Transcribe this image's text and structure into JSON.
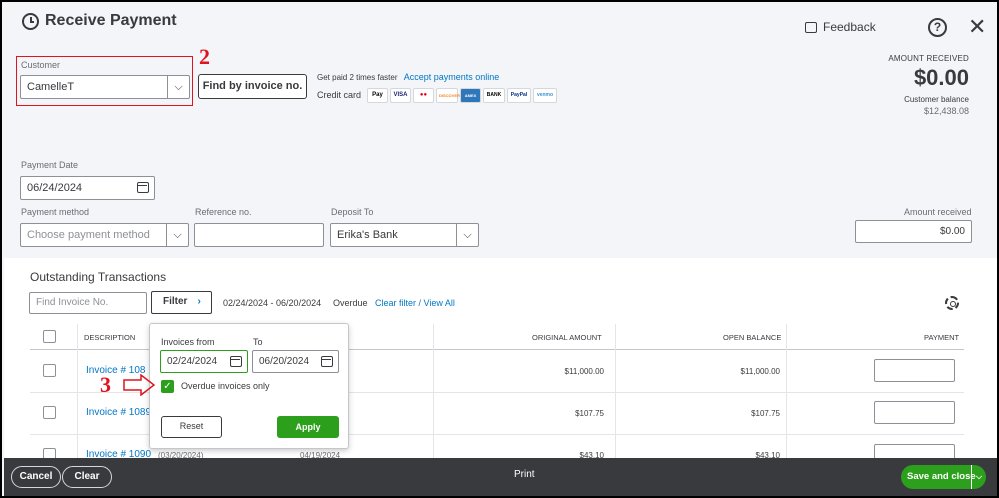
{
  "header": {
    "title": "Receive Payment",
    "feedback": "Feedback",
    "help": "?",
    "close": "✕"
  },
  "customer": {
    "label": "Customer",
    "value": "CamelleT",
    "find_button": "Find by invoice no."
  },
  "annotations": {
    "two": "2",
    "three": "3"
  },
  "promo": {
    "get_paid": "Get paid 2 times faster",
    "accept_link": "Accept payments online",
    "credit_card": "Credit card",
    "cards": [
      "Pay",
      "VISA",
      "●●",
      "DISCOVER",
      "AMEX",
      "BANK",
      "PayPal",
      "venmo"
    ]
  },
  "amount_received_top": {
    "label": "AMOUNT RECEIVED",
    "value": "$0.00",
    "balance_label": "Customer balance",
    "balance_value": "$12,438.08"
  },
  "payment_date": {
    "label": "Payment Date",
    "value": "06/24/2024"
  },
  "payment_method": {
    "label": "Payment method",
    "placeholder": "Choose payment method"
  },
  "reference": {
    "label": "Reference no.",
    "value": ""
  },
  "deposit_to": {
    "label": "Deposit To",
    "value": "Erika's Bank"
  },
  "amount_received": {
    "label": "Amount received",
    "value": "$0.00"
  },
  "outstanding": {
    "title": "Outstanding Transactions",
    "find_placeholder": "Find Invoice No.",
    "filter_label": "Filter",
    "filter_range": "02/24/2024 - 06/20/2024",
    "filter_overdue": "Overdue",
    "clear_filter": "Clear filter / View All",
    "columns": {
      "description": "DESCRIPTION",
      "original": "ORIGINAL AMOUNT",
      "open": "OPEN BALANCE",
      "payment": "PAYMENT"
    },
    "rows": [
      {
        "invoice": "Invoice # 108",
        "date": "",
        "due": "",
        "original": "$11,000.00",
        "open": "$11,000.00"
      },
      {
        "invoice": "Invoice # 1089",
        "date": "",
        "due": "",
        "original": "$107.75",
        "open": "$107.75"
      },
      {
        "invoice": "Invoice # 1090",
        "date": "(03/20/2024)",
        "due": "04/19/2024",
        "original": "$43.10",
        "open": "$43.10"
      }
    ]
  },
  "filter_popover": {
    "from_label": "Invoices from",
    "from_value": "02/24/2024",
    "to_label": "To",
    "to_value": "06/20/2024",
    "overdue_only": "Overdue invoices only",
    "reset": "Reset",
    "apply": "Apply"
  },
  "footer": {
    "cancel": "Cancel",
    "clear": "Clear",
    "print": "Print",
    "save_close": "Save and close"
  },
  "colors": {
    "green": "#2ca01c",
    "link": "#0077c5",
    "annotation_red": "#e0141e",
    "footer_bg": "#393a3d"
  }
}
